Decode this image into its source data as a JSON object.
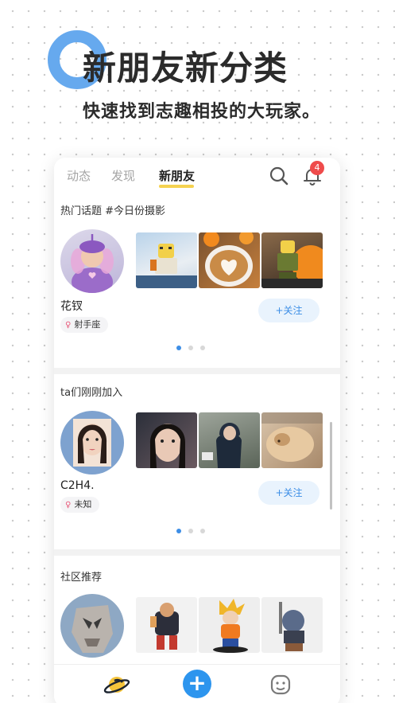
{
  "promo": {
    "title": "新朋友新分类",
    "subtitle": "快速找到志趣相投的大玩家。"
  },
  "tabs": [
    {
      "label": "动态",
      "active": false
    },
    {
      "label": "发现",
      "active": false
    },
    {
      "label": "新朋友",
      "active": true
    }
  ],
  "notifications": {
    "count": "4"
  },
  "sections": [
    {
      "title": "热门话题 #今日份摄影",
      "user": {
        "name": "花钗",
        "tag": "射手座"
      },
      "follow_label": "+关注",
      "thumbs": [
        "lego-figure-photo",
        "latte-art-photo",
        "lego-pumpkin-photo"
      ]
    },
    {
      "title": "ta们刚刚加入",
      "user": {
        "name": "C2H4.",
        "tag": "未知"
      },
      "follow_label": "+关注",
      "thumbs": [
        "girl-portrait-photo",
        "man-hoodie-photo",
        "sleeping-dog-photo"
      ]
    },
    {
      "title": "社区推荐",
      "thumbs": [
        "figure-luffy-photo",
        "figure-goku-photo",
        "figure-beast-photo"
      ]
    }
  ],
  "colors": {
    "accent": "#3d8ee6",
    "ring": "#66a9ee",
    "underline": "#f5d250",
    "badge": "#ef4b4b"
  },
  "nav": [
    "planet-icon",
    "plus-icon",
    "face-icon"
  ]
}
